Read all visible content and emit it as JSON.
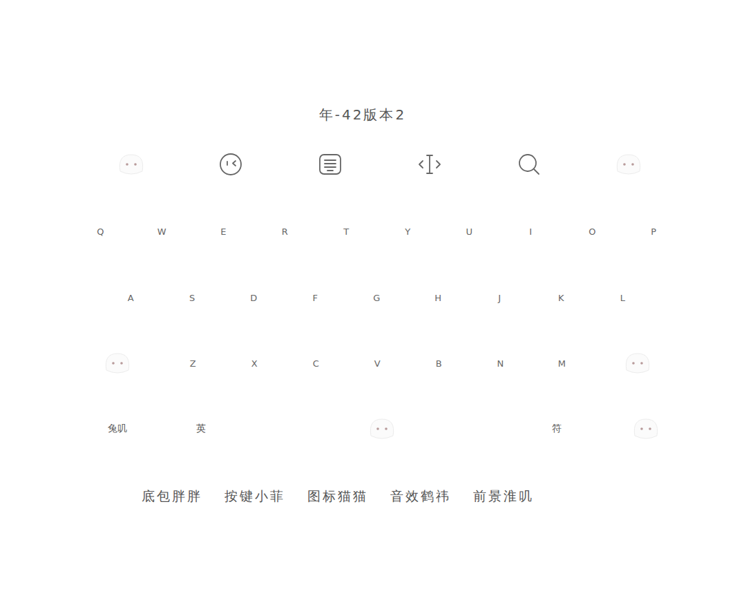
{
  "title": "年-42版本2",
  "keyboard": {
    "rows": [
      [
        "Q",
        "W",
        "E",
        "R",
        "T",
        "Y",
        "U",
        "I",
        "O",
        "P"
      ],
      [
        "A",
        "S",
        "D",
        "F",
        "G",
        "H",
        "J",
        "K",
        "L"
      ],
      [
        "Z",
        "X",
        "C",
        "V",
        "B",
        "N",
        "M"
      ]
    ],
    "bottom_row": [
      "兔叽",
      "英",
      "符"
    ]
  },
  "credits": [
    "底包胖胖",
    "按键小菲",
    "图标猫猫",
    "音效鹤祎",
    "前景淮叽"
  ]
}
